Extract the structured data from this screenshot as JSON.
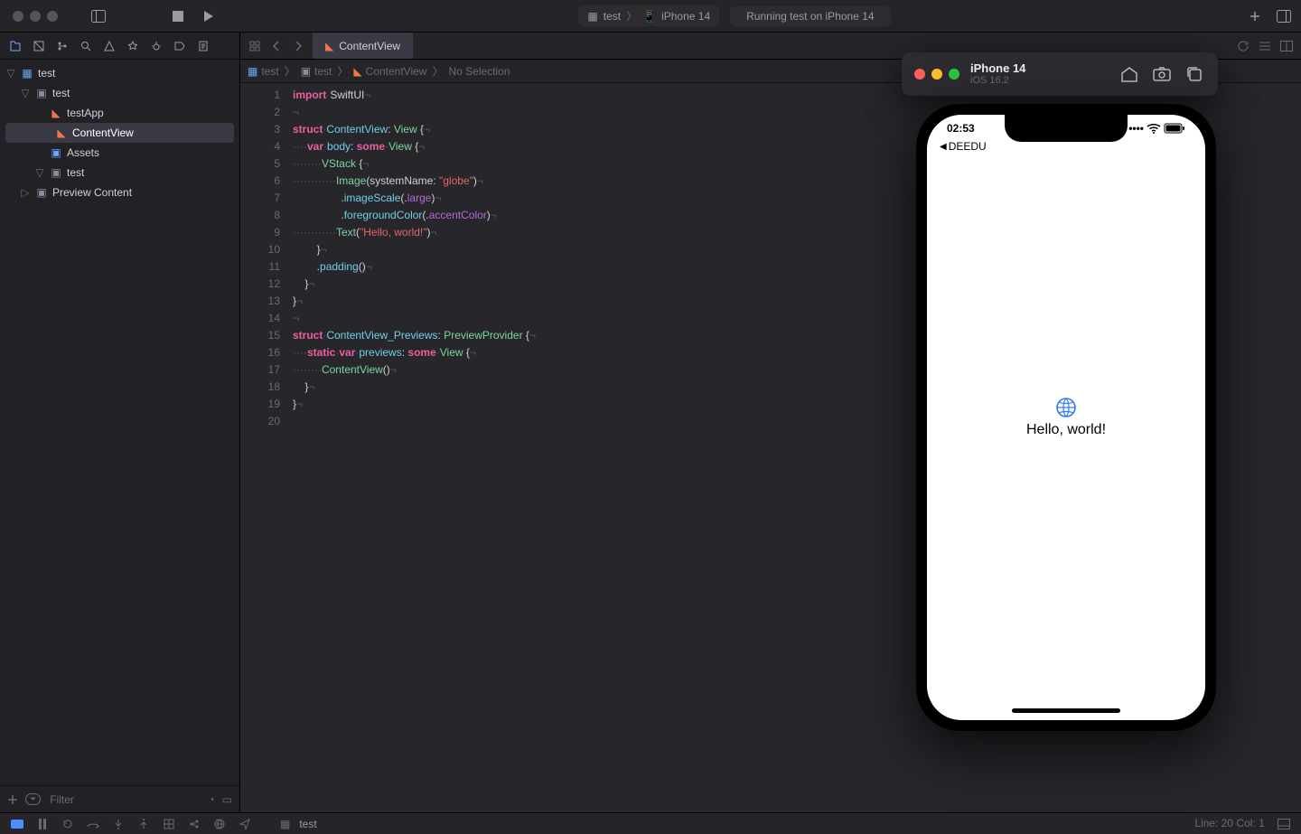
{
  "titlebar": {
    "project": "test",
    "scheme_target": "test",
    "scheme_device": "iPhone 14",
    "status": "Running test on iPhone 14"
  },
  "navigator": {
    "root": "test",
    "items": [
      {
        "label": "test",
        "kind": "group",
        "depth": 1
      },
      {
        "label": "testApp",
        "kind": "swift",
        "depth": 2
      },
      {
        "label": "ContentView",
        "kind": "swift",
        "depth": 2,
        "selected": true
      },
      {
        "label": "Assets",
        "kind": "asset",
        "depth": 2
      },
      {
        "label": "test",
        "kind": "group",
        "depth": 2
      },
      {
        "label": "Preview Content",
        "kind": "group",
        "depth": 1
      }
    ],
    "filter_placeholder": "Filter"
  },
  "tabs": {
    "active": "ContentView"
  },
  "jumpbar": [
    "test",
    "test",
    "ContentView",
    "No Selection"
  ],
  "code": {
    "lines": [
      [
        {
          "t": "import",
          "c": "kw"
        },
        {
          "t": " "
        },
        {
          "t": "SwiftUI",
          "c": ""
        }
      ],
      [],
      [
        {
          "t": "struct",
          "c": "kw"
        },
        {
          "t": " "
        },
        {
          "t": "ContentView",
          "c": "id"
        },
        {
          "t": ": "
        },
        {
          "t": "View",
          "c": "ty"
        },
        {
          "t": " {"
        }
      ],
      [
        {
          "t": "    "
        },
        {
          "t": "var",
          "c": "kw"
        },
        {
          "t": " "
        },
        {
          "t": "body",
          "c": "id"
        },
        {
          "t": ": "
        },
        {
          "t": "some",
          "c": "kw"
        },
        {
          "t": " "
        },
        {
          "t": "View",
          "c": "ty"
        },
        {
          "t": " {"
        }
      ],
      [
        {
          "t": "        "
        },
        {
          "t": "VStack",
          "c": "ty"
        },
        {
          "t": " {"
        }
      ],
      [
        {
          "t": "            "
        },
        {
          "t": "Image",
          "c": "ty"
        },
        {
          "t": "("
        },
        {
          "t": "systemName",
          "c": ""
        },
        {
          "t": ": "
        },
        {
          "t": "\"globe\"",
          "c": "str"
        },
        {
          "t": ")"
        }
      ],
      [
        {
          "t": "                ."
        },
        {
          "t": "imageScale",
          "c": "id"
        },
        {
          "t": "(."
        },
        {
          "t": "large",
          "c": "kw2"
        },
        {
          "t": ")"
        }
      ],
      [
        {
          "t": "                ."
        },
        {
          "t": "foregroundColor",
          "c": "id"
        },
        {
          "t": "(."
        },
        {
          "t": "accentColor",
          "c": "kw2"
        },
        {
          "t": ")"
        }
      ],
      [
        {
          "t": "            "
        },
        {
          "t": "Text",
          "c": "ty"
        },
        {
          "t": "("
        },
        {
          "t": "\"Hello, world!\"",
          "c": "str"
        },
        {
          "t": ")"
        }
      ],
      [
        {
          "t": "        }"
        }
      ],
      [
        {
          "t": "        ."
        },
        {
          "t": "padding",
          "c": "id"
        },
        {
          "t": "()"
        }
      ],
      [
        {
          "t": "    }"
        }
      ],
      [
        {
          "t": "}"
        }
      ],
      [],
      [
        {
          "t": "struct",
          "c": "kw"
        },
        {
          "t": " "
        },
        {
          "t": "ContentView_Previews",
          "c": "id"
        },
        {
          "t": ": "
        },
        {
          "t": "PreviewProvider",
          "c": "ty"
        },
        {
          "t": " {"
        }
      ],
      [
        {
          "t": "    "
        },
        {
          "t": "static",
          "c": "kw"
        },
        {
          "t": " "
        },
        {
          "t": "var",
          "c": "kw"
        },
        {
          "t": " "
        },
        {
          "t": "previews",
          "c": "id"
        },
        {
          "t": ": "
        },
        {
          "t": "some",
          "c": "kw"
        },
        {
          "t": " "
        },
        {
          "t": "View",
          "c": "ty"
        },
        {
          "t": " {"
        }
      ],
      [
        {
          "t": "        "
        },
        {
          "t": "ContentView",
          "c": "ty"
        },
        {
          "t": "()"
        }
      ],
      [
        {
          "t": "    }"
        }
      ],
      [
        {
          "t": "}"
        }
      ],
      []
    ]
  },
  "simulator": {
    "device": "iPhone 14",
    "os": "iOS 16.2",
    "clock": "02:53",
    "back_app": "DEEDU",
    "app_text": "Hello, world!"
  },
  "statusbar": {
    "target": "test",
    "position": "Line: 20  Col: 1"
  }
}
